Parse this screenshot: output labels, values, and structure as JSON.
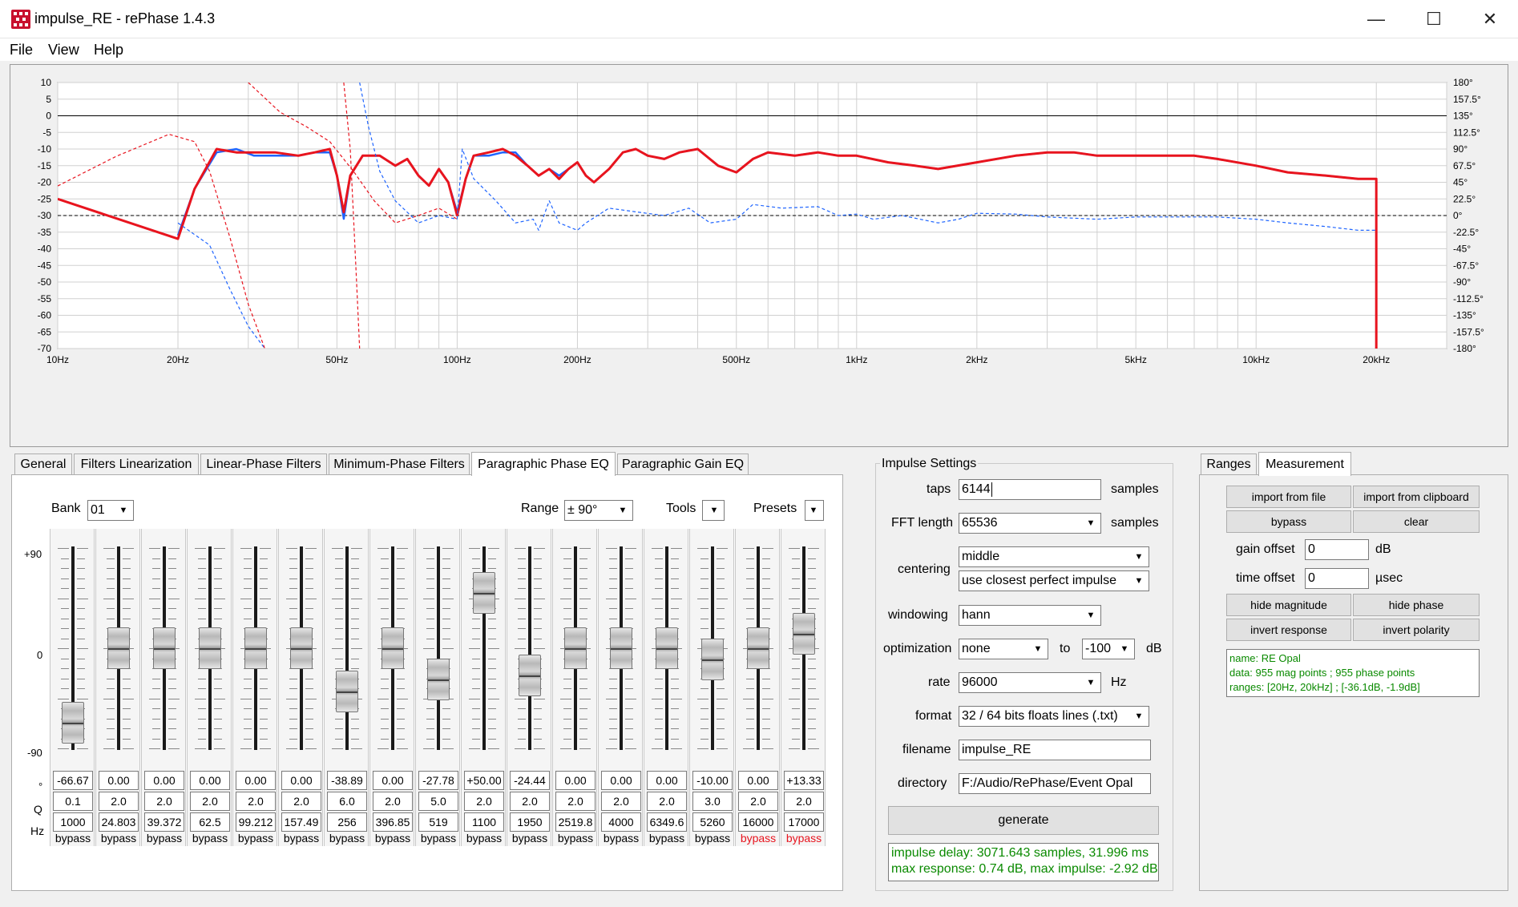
{
  "window": {
    "title": "impulse_RE  -  rePhase 1.4.3",
    "minimize": "—",
    "maximize": "☐",
    "close": "✕"
  },
  "menu": [
    {
      "label": "File"
    },
    {
      "label": "View"
    },
    {
      "label": "Help"
    }
  ],
  "chart_data": {
    "type": "line",
    "x_scale": "log",
    "xlim": [
      10,
      30000
    ],
    "ylim": [
      -70,
      10
    ],
    "y2lim": [
      -180,
      180
    ],
    "grid": true,
    "x_ticks": [
      {
        "v": 10,
        "label": "10Hz"
      },
      {
        "v": 20,
        "label": "20Hz"
      },
      {
        "v": 50,
        "label": "50Hz"
      },
      {
        "v": 100,
        "label": "100Hz"
      },
      {
        "v": 200,
        "label": "200Hz"
      },
      {
        "v": 500,
        "label": "500Hz"
      },
      {
        "v": 1000,
        "label": "1kHz"
      },
      {
        "v": 2000,
        "label": "2kHz"
      },
      {
        "v": 5000,
        "label": "5kHz"
      },
      {
        "v": 10000,
        "label": "10kHz"
      },
      {
        "v": 20000,
        "label": "20kHz"
      }
    ],
    "y_ticks": [
      "10",
      "5",
      "0",
      "-5",
      "-10",
      "-15",
      "-20",
      "-25",
      "-30",
      "-35",
      "-40",
      "-45",
      "-50",
      "-55",
      "-60",
      "-65",
      "-70"
    ],
    "y2_ticks": [
      "180°",
      "157.5°",
      "135°",
      "112.5°",
      "90°",
      "67.5°",
      "45°",
      "22.5°",
      "0°",
      "-22.5°",
      "-45°",
      "-67.5°",
      "-90°",
      "-112.5°",
      "-135°",
      "-157.5°",
      "-180°"
    ],
    "series": [
      {
        "role": "magnitude-original",
        "color": "#1e64ff",
        "dashed": false,
        "points": [
          [
            20,
            -36
          ],
          [
            22,
            -22
          ],
          [
            25,
            -11
          ],
          [
            28,
            -10
          ],
          [
            31,
            -12
          ],
          [
            35,
            -12
          ],
          [
            40,
            -12
          ],
          [
            44,
            -11
          ],
          [
            48,
            -11
          ],
          [
            50,
            -18
          ],
          [
            52,
            -31
          ],
          [
            54,
            -18
          ],
          [
            58,
            -12
          ],
          [
            64,
            -12
          ],
          [
            70,
            -15
          ],
          [
            75,
            -13
          ],
          [
            80,
            -18
          ],
          [
            85,
            -21
          ],
          [
            90,
            -16
          ],
          [
            95,
            -20
          ],
          [
            100,
            -29
          ],
          [
            105,
            -19
          ],
          [
            110,
            -12
          ],
          [
            120,
            -12
          ],
          [
            130,
            -11
          ],
          [
            140,
            -11
          ],
          [
            150,
            -15
          ],
          [
            160,
            -18
          ],
          [
            170,
            -16
          ],
          [
            180,
            -18
          ],
          [
            190,
            -16
          ],
          [
            200,
            -14
          ],
          [
            210,
            -18
          ],
          [
            220,
            -20
          ],
          [
            240,
            -16
          ],
          [
            260,
            -11
          ],
          [
            280,
            -10
          ],
          [
            300,
            -12
          ],
          [
            330,
            -13
          ],
          [
            360,
            -11
          ],
          [
            400,
            -10
          ],
          [
            450,
            -15
          ],
          [
            500,
            -17
          ],
          [
            550,
            -13
          ],
          [
            600,
            -11
          ],
          [
            700,
            -12
          ],
          [
            800,
            -11
          ],
          [
            900,
            -12
          ],
          [
            1000,
            -12
          ],
          [
            1200,
            -14
          ],
          [
            1400,
            -15
          ],
          [
            1600,
            -16
          ],
          [
            2000,
            -14
          ],
          [
            2500,
            -12
          ],
          [
            3000,
            -11
          ],
          [
            3500,
            -11
          ],
          [
            4000,
            -12
          ],
          [
            5000,
            -12
          ],
          [
            6000,
            -12
          ],
          [
            7000,
            -12
          ],
          [
            8000,
            -13
          ],
          [
            10000,
            -15
          ],
          [
            12000,
            -17
          ],
          [
            15000,
            -18
          ],
          [
            18000,
            -19
          ],
          [
            20000,
            -19
          ],
          [
            20000,
            -70
          ]
        ]
      },
      {
        "role": "magnitude-processed",
        "color": "#e8141e",
        "dashed": false,
        "points": [
          [
            10,
            -25
          ],
          [
            20,
            -37
          ],
          [
            22,
            -22
          ],
          [
            25,
            -10
          ],
          [
            28,
            -11
          ],
          [
            31,
            -11
          ],
          [
            35,
            -11
          ],
          [
            40,
            -12
          ],
          [
            44,
            -11
          ],
          [
            48,
            -10
          ],
          [
            50,
            -18
          ],
          [
            52,
            -29
          ],
          [
            54,
            -18
          ],
          [
            58,
            -12
          ],
          [
            64,
            -12
          ],
          [
            70,
            -15
          ],
          [
            75,
            -13
          ],
          [
            80,
            -18
          ],
          [
            85,
            -21
          ],
          [
            90,
            -16
          ],
          [
            95,
            -20
          ],
          [
            100,
            -30
          ],
          [
            105,
            -19
          ],
          [
            110,
            -12
          ],
          [
            120,
            -11
          ],
          [
            130,
            -10
          ],
          [
            140,
            -12
          ],
          [
            150,
            -15
          ],
          [
            160,
            -18
          ],
          [
            170,
            -16
          ],
          [
            180,
            -19
          ],
          [
            190,
            -16
          ],
          [
            200,
            -14
          ],
          [
            210,
            -18
          ],
          [
            220,
            -20
          ],
          [
            240,
            -16
          ],
          [
            260,
            -11
          ],
          [
            280,
            -10
          ],
          [
            300,
            -12
          ],
          [
            330,
            -13
          ],
          [
            360,
            -11
          ],
          [
            400,
            -10
          ],
          [
            450,
            -15
          ],
          [
            500,
            -17
          ],
          [
            550,
            -13
          ],
          [
            600,
            -11
          ],
          [
            700,
            -12
          ],
          [
            800,
            -11
          ],
          [
            900,
            -12
          ],
          [
            1000,
            -12
          ],
          [
            1200,
            -14
          ],
          [
            1400,
            -15
          ],
          [
            1600,
            -16
          ],
          [
            2000,
            -14
          ],
          [
            2500,
            -12
          ],
          [
            3000,
            -11
          ],
          [
            3500,
            -11
          ],
          [
            4000,
            -12
          ],
          [
            5000,
            -12
          ],
          [
            6000,
            -12
          ],
          [
            7000,
            -12
          ],
          [
            8000,
            -13
          ],
          [
            10000,
            -15
          ],
          [
            12000,
            -17
          ],
          [
            15000,
            -18
          ],
          [
            18000,
            -19
          ],
          [
            20000,
            -19
          ],
          [
            20000,
            -70
          ]
        ]
      },
      {
        "role": "phase-original",
        "color": "#1e64ff",
        "dashed": true,
        "points": [
          [
            20,
            -10
          ],
          [
            24,
            -40
          ],
          [
            27,
            -100
          ],
          [
            30,
            -150
          ],
          [
            33,
            -180
          ]
        ]
      },
      {
        "role": "phase-processed",
        "color": "#e8141e",
        "dashed": true,
        "points": [
          [
            10,
            40
          ],
          [
            14,
            80
          ],
          [
            19,
            110
          ],
          [
            22,
            100
          ],
          [
            24,
            60
          ],
          [
            27,
            -30
          ],
          [
            30,
            -120
          ],
          [
            33,
            -180
          ]
        ]
      },
      {
        "role": "phase-upper",
        "color": "#e8141e",
        "dashed": true,
        "points": [
          [
            30,
            180
          ],
          [
            36,
            140
          ],
          [
            42,
            120
          ],
          [
            48,
            100
          ],
          [
            55,
            60
          ],
          [
            62,
            20
          ],
          [
            70,
            -10
          ],
          [
            80,
            0
          ],
          [
            90,
            10
          ],
          [
            100,
            -5
          ]
        ]
      },
      {
        "role": "phase-middle",
        "color": "#1e64ff",
        "dashed": true,
        "points": [
          [
            100,
            -5
          ],
          [
            103,
            90
          ],
          [
            110,
            50
          ],
          [
            125,
            20
          ],
          [
            140,
            -10
          ],
          [
            155,
            -5
          ],
          [
            160,
            -20
          ],
          [
            170,
            20
          ],
          [
            180,
            -10
          ],
          [
            200,
            -20
          ],
          [
            210,
            -10
          ],
          [
            240,
            10
          ],
          [
            280,
            5
          ],
          [
            330,
            0
          ],
          [
            380,
            10
          ],
          [
            430,
            -10
          ],
          [
            500,
            -5
          ],
          [
            550,
            15
          ],
          [
            650,
            10
          ],
          [
            800,
            12
          ],
          [
            900,
            0
          ],
          [
            1000,
            2
          ],
          [
            1100,
            -5
          ],
          [
            1300,
            0
          ],
          [
            1600,
            -10
          ],
          [
            1800,
            -5
          ],
          [
            2000,
            3
          ],
          [
            2500,
            2
          ],
          [
            3000,
            -2
          ],
          [
            4000,
            -5
          ],
          [
            5000,
            -2
          ],
          [
            6000,
            -2
          ],
          [
            8000,
            -2
          ],
          [
            10000,
            -5
          ],
          [
            12000,
            -10
          ],
          [
            15000,
            -15
          ],
          [
            18000,
            -20
          ],
          [
            20000,
            -20
          ]
        ]
      },
      {
        "role": "phase-steep-left",
        "color": "#e8141e",
        "dashed": true,
        "points": [
          [
            52,
            180
          ],
          [
            54,
            90
          ],
          [
            55,
            0
          ],
          [
            56,
            -90
          ],
          [
            57,
            -180
          ]
        ]
      },
      {
        "role": "phase-steep-right",
        "color": "#1e64ff",
        "dashed": true,
        "points": [
          [
            57,
            180
          ],
          [
            60,
            120
          ],
          [
            64,
            60
          ],
          [
            70,
            20
          ],
          [
            80,
            -10
          ],
          [
            90,
            0
          ],
          [
            100,
            -5
          ]
        ]
      }
    ]
  },
  "tabs": [
    {
      "label": "General"
    },
    {
      "label": "Filters Linearization"
    },
    {
      "label": "Linear-Phase Filters"
    },
    {
      "label": "Minimum-Phase Filters"
    },
    {
      "label": "Paragraphic Phase EQ"
    },
    {
      "label": "Paragraphic Gain EQ"
    }
  ],
  "eq": {
    "bank_label": "Bank",
    "bank_value": "01",
    "range_label": "Range",
    "range_value": "± 90°",
    "tools_label": "Tools",
    "presets_label": "Presets",
    "scale_top": "+90",
    "scale_mid": "0",
    "scale_bottom": "-90",
    "row_deg": "°",
    "row_q": "Q",
    "row_hz": "Hz",
    "bands": [
      {
        "deg": "-66.67",
        "q": "0.1",
        "hz": "1000",
        "bypass": "bypass",
        "level": -0.741,
        "red": false
      },
      {
        "deg": "0.00",
        "q": "2.0",
        "hz": "24.803",
        "bypass": "bypass",
        "level": 0,
        "red": false
      },
      {
        "deg": "0.00",
        "q": "2.0",
        "hz": "39.372",
        "bypass": "bypass",
        "level": 0,
        "red": false
      },
      {
        "deg": "0.00",
        "q": "2.0",
        "hz": "62.5",
        "bypass": "bypass",
        "level": 0,
        "red": false
      },
      {
        "deg": "0.00",
        "q": "2.0",
        "hz": "99.212",
        "bypass": "bypass",
        "level": 0,
        "red": false
      },
      {
        "deg": "0.00",
        "q": "2.0",
        "hz": "157.49",
        "bypass": "bypass",
        "level": 0,
        "red": false
      },
      {
        "deg": "-38.89",
        "q": "6.0",
        "hz": "256",
        "bypass": "bypass",
        "level": -0.432,
        "red": false
      },
      {
        "deg": "0.00",
        "q": "2.0",
        "hz": "396.85",
        "bypass": "bypass",
        "level": 0,
        "red": false
      },
      {
        "deg": "-27.78",
        "q": "5.0",
        "hz": "519",
        "bypass": "bypass",
        "level": -0.309,
        "red": false
      },
      {
        "deg": "+50.00",
        "q": "2.0",
        "hz": "1100",
        "bypass": "bypass",
        "level": 0.556,
        "red": false
      },
      {
        "deg": "-24.44",
        "q": "2.0",
        "hz": "1950",
        "bypass": "bypass",
        "level": -0.272,
        "red": false
      },
      {
        "deg": "0.00",
        "q": "2.0",
        "hz": "2519.8",
        "bypass": "bypass",
        "level": 0,
        "red": false
      },
      {
        "deg": "0.00",
        "q": "2.0",
        "hz": "4000",
        "bypass": "bypass",
        "level": 0,
        "red": false
      },
      {
        "deg": "0.00",
        "q": "2.0",
        "hz": "6349.6",
        "bypass": "bypass",
        "level": 0,
        "red": false
      },
      {
        "deg": "-10.00",
        "q": "3.0",
        "hz": "5260",
        "bypass": "bypass",
        "level": -0.111,
        "red": false
      },
      {
        "deg": "0.00",
        "q": "2.0",
        "hz": "16000",
        "bypass": "bypass",
        "level": 0,
        "red": true
      },
      {
        "deg": "+13.33",
        "q": "2.0",
        "hz": "17000",
        "bypass": "bypass",
        "level": 0.148,
        "red": true
      }
    ]
  },
  "impulse": {
    "group_title": "Impulse Settings",
    "taps_label": "taps",
    "taps_value": "6144",
    "taps_unit": "samples",
    "fft_label": "FFT length",
    "fft_value": "65536",
    "fft_unit": "samples",
    "centering_label": "centering",
    "centering_value": "middle",
    "centering_value2": "use closest perfect impulse",
    "windowing_label": "windowing",
    "windowing_value": "hann",
    "optimization_label": "optimization",
    "optimization_value": "none",
    "to_label": "to",
    "to_value": "-100",
    "opt_unit": "dB",
    "rate_label": "rate",
    "rate_value": "96000",
    "rate_unit": "Hz",
    "format_label": "format",
    "format_value": "32 / 64 bits floats lines (.txt)",
    "filename_label": "filename",
    "filename_value": "impulse_RE",
    "directory_label": "directory",
    "directory_value": "F:/Audio/RePhase/Event Opal",
    "generate": "generate",
    "status1": "impulse delay: 3071.643 samples, 31.996 ms",
    "status2": "max response: 0.74 dB, max impulse: -2.92 dB"
  },
  "measurement": {
    "tab_ranges": "Ranges",
    "tab_measurement": "Measurement",
    "import_file": "import from file",
    "import_clipboard": "import from clipboard",
    "bypass": "bypass",
    "clear": "clear",
    "gain_label": "gain offset",
    "gain_value": "0",
    "gain_unit": "dB",
    "time_label": "time offset",
    "time_value": "0",
    "time_unit": "µsec",
    "hide_mag": "hide magnitude",
    "hide_phase": "hide phase",
    "invert_response": "invert response",
    "invert_polarity": "invert polarity",
    "info1": "name: RE Opal",
    "info2": "data: 955 mag points ; 955 phase points",
    "info3": "ranges: [20Hz, 20kHz] ; [-36.1dB, -1.9dB]"
  },
  "colors": {
    "accent_red": "#e8141e",
    "accent_blue": "#1e64ff",
    "status_green": "#0a8a00",
    "bypass_red": "#e8141e"
  }
}
